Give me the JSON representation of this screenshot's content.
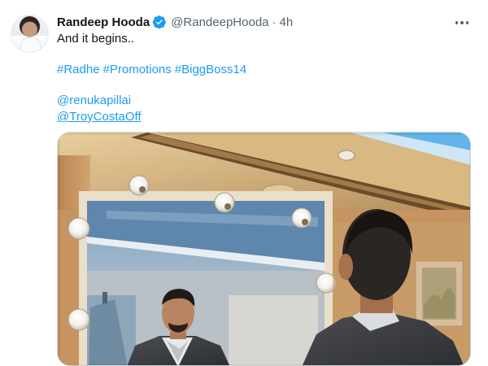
{
  "tweet": {
    "author_name": "Randeep Hooda",
    "handle": "@RandeepHooda",
    "separator": "·",
    "time": "4h",
    "text": "And it begins..",
    "hashtags": [
      "#Radhe",
      "#Promotions",
      "#BiggBoss14"
    ],
    "mentions": [
      "@renukapillai",
      "@TroyCostaOff"
    ]
  },
  "icons": {
    "verified": "verified-badge-icon",
    "more": "more-options-icon"
  },
  "colors": {
    "link": "#1d9bf0",
    "verified": "#1d9bf0",
    "muted": "#536471"
  }
}
